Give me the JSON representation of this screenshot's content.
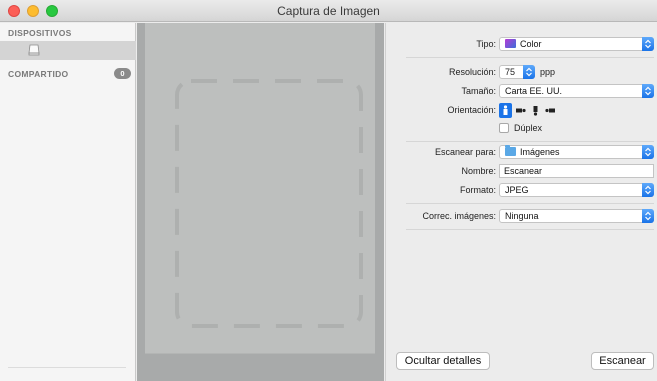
{
  "window": {
    "title": "Captura de Imagen"
  },
  "sidebar": {
    "devices_heading": "DISPOSITIVOS",
    "shared_heading": "COMPARTIDO",
    "shared_count": "0"
  },
  "settings": {
    "type_label": "Tipo:",
    "type_value": "Color",
    "resolution_label": "Resolución:",
    "resolution_value": "75",
    "resolution_unit": "ppp",
    "size_label": "Tamaño:",
    "size_value": "Carta EE. UU.",
    "orientation_label": "Orientación:",
    "duplex_label": "Dúplex",
    "duplex_checked": false,
    "scan_to_label": "Escanear para:",
    "scan_to_value": "Imágenes",
    "name_label": "Nombre:",
    "name_value": "Escanear",
    "format_label": "Formato:",
    "format_value": "JPEG",
    "correction_label": "Correc. imágenes:",
    "correction_value": "Ninguna"
  },
  "buttons": {
    "hide_details": "Ocultar detalles",
    "scan": "Escanear"
  },
  "colors": {
    "accent": "#1a73e8",
    "sidebar_selected": "#d4d4d4",
    "preview_bg": "#a8aaaa",
    "paper": "#bdbfbe"
  }
}
